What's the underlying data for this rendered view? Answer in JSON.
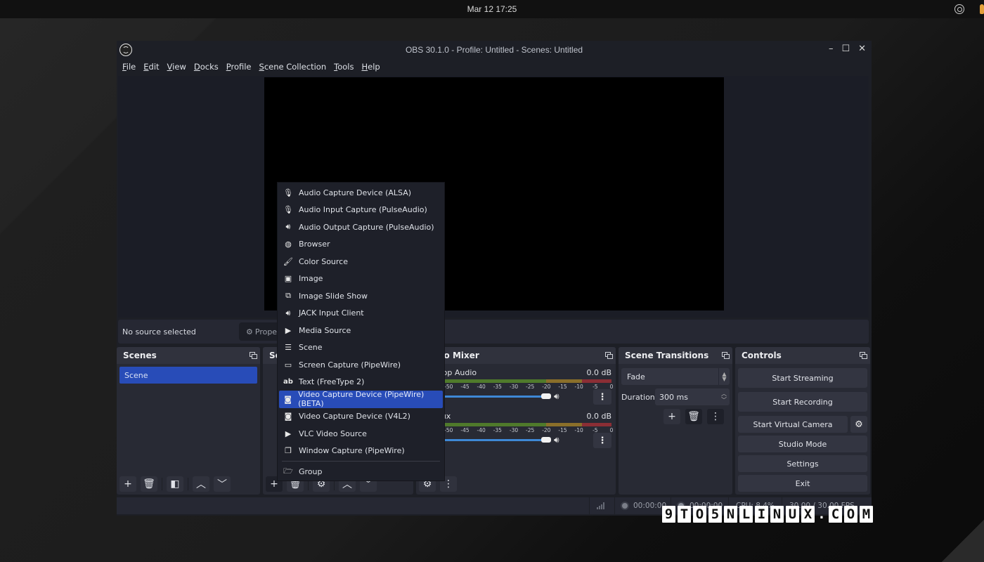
{
  "topbar": {
    "clock": "Mar 12  17:25",
    "tray_icons": [
      "obs-tray-icon",
      "microphone-indicator-icon"
    ]
  },
  "window": {
    "title": "OBS 30.1.0 - Profile: Untitled - Scenes: Untitled",
    "controls": {
      "minimize": "–",
      "maximize": "☐",
      "close": "✕"
    }
  },
  "menubar": [
    "File",
    "Edit",
    "View",
    "Docks",
    "Profile",
    "Scene Collection",
    "Tools",
    "Help"
  ],
  "source_toolbar": {
    "status": "No source selected",
    "properties_label": "Properties"
  },
  "docks": {
    "scenes": {
      "title": "Scenes",
      "items": [
        "Scene"
      ],
      "selected": "Scene"
    },
    "sources": {
      "title": "Sources"
    },
    "mixer": {
      "title": "Audio Mixer",
      "channels": [
        {
          "name": "Desktop Audio",
          "level": "0.0 dB",
          "volume_fraction": 1.0
        },
        {
          "name": "Mic/Aux",
          "level": "0.0 dB",
          "volume_fraction": 1.0
        }
      ],
      "scale_ticks": [
        "-50",
        "-45",
        "-40",
        "-35",
        "-30",
        "-25",
        "-20",
        "-15",
        "-10",
        "-5",
        "0"
      ]
    },
    "transitions": {
      "title": "Scene Transitions",
      "selected_transition": "Fade",
      "duration_label": "Duration",
      "duration_value": "300 ms"
    },
    "controls": {
      "title": "Controls",
      "buttons": [
        "Start Streaming",
        "Start Recording",
        "Start Virtual Camera",
        "Studio Mode",
        "Settings",
        "Exit"
      ]
    }
  },
  "statusbar": {
    "stream_time": "00:00:00",
    "record_time": "00:00:00",
    "cpu": "CPU: 8.4%",
    "fps": "30.00 / 30.00 FPS"
  },
  "context_menu": {
    "items": [
      {
        "label": "Audio Capture Device (ALSA)",
        "icon": "microphone-icon"
      },
      {
        "label": "Audio Input Capture (PulseAudio)",
        "icon": "microphone-icon"
      },
      {
        "label": "Audio Output Capture (PulseAudio)",
        "icon": "speaker-icon"
      },
      {
        "label": "Browser",
        "icon": "globe-icon"
      },
      {
        "label": "Color Source",
        "icon": "paint-brush-icon"
      },
      {
        "label": "Image",
        "icon": "image-icon"
      },
      {
        "label": "Image Slide Show",
        "icon": "slideshow-icon"
      },
      {
        "label": "JACK Input Client",
        "icon": "speaker-icon"
      },
      {
        "label": "Media Source",
        "icon": "play-icon"
      },
      {
        "label": "Scene",
        "icon": "list-icon"
      },
      {
        "label": "Screen Capture (PipeWire)",
        "icon": "monitor-icon"
      },
      {
        "label": "Text (FreeType 2)",
        "icon": "text-icon"
      },
      {
        "label": "Video Capture Device (PipeWire) (BETA)",
        "icon": "camera-icon"
      },
      {
        "label": "Video Capture Device (V4L2)",
        "icon": "camera-icon"
      },
      {
        "label": "VLC Video Source",
        "icon": "play-icon"
      },
      {
        "label": "Window Capture (PipeWire)",
        "icon": "window-icon"
      }
    ],
    "group_item": {
      "label": "Group",
      "icon": "folder-icon"
    },
    "highlighted": "Video Capture Device (PipeWire) (BETA)"
  },
  "watermark": "9TO5NLINUX.COM",
  "colors": {
    "accent": "#284cb8",
    "volume_slider": "#3e88d6",
    "meter_green": "#4f7a2b",
    "meter_yellow": "#8a6f2a",
    "meter_red": "#8b2e35"
  }
}
